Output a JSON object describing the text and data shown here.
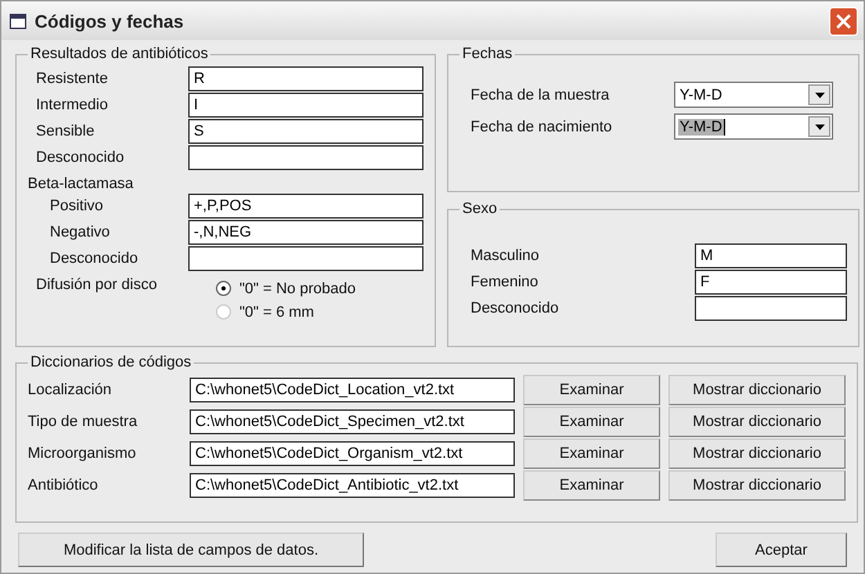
{
  "window": {
    "title": "Códigos y fechas"
  },
  "antibiotic_results": {
    "title": "Resultados de antibióticos",
    "fields": [
      {
        "label": "Resistente",
        "value": "R"
      },
      {
        "label": "Intermedio",
        "value": "I"
      },
      {
        "label": "Sensible",
        "value": "S"
      },
      {
        "label": "Desconocido"
      }
    ],
    "beta_lactamase": {
      "title": "Beta-lactamasa",
      "fields": [
        {
          "label": "Positivo",
          "value": "+,P,POS"
        },
        {
          "label": "Negativo",
          "value": "-,N,NEG"
        },
        {
          "label": "Desconocido"
        }
      ]
    },
    "disk_diffusion": {
      "label": "Difusión por disco",
      "options": [
        {
          "label": "\"0\" = No probado",
          "selected": true
        },
        {
          "label": "\"0\" = 6 mm",
          "selected": false
        }
      ]
    }
  },
  "dates": {
    "title": "Fechas",
    "fields": [
      {
        "label": "Fecha de la muestra",
        "value": "Y-M-D",
        "focused": false
      },
      {
        "label": "Fecha de nacimiento",
        "value": "Y-M-D",
        "focused": true
      }
    ]
  },
  "sex": {
    "title": "Sexo",
    "fields": [
      {
        "label": "Masculino",
        "value": "M"
      },
      {
        "label": "Femenino",
        "value": "F"
      },
      {
        "label": "Desconocido"
      }
    ]
  },
  "dictionaries": {
    "title": "Diccionarios de códigos",
    "rows": [
      {
        "label": "Localización",
        "path": "C:\\whonet5\\CodeDict_Location_vt2.txt",
        "browse": "Examinar",
        "show": "Mostrar diccionario"
      },
      {
        "label": "Tipo de muestra",
        "path": "C:\\whonet5\\CodeDict_Specimen_vt2.txt",
        "browse": "Examinar",
        "show": "Mostrar diccionario"
      },
      {
        "label": "Microorganismo",
        "path": "C:\\whonet5\\CodeDict_Organism_vt2.txt",
        "browse": "Examinar",
        "show": "Mostrar diccionario"
      },
      {
        "label": "Antibiótico",
        "path": "C:\\whonet5\\CodeDict_Antibiotic_vt2.txt",
        "browse": "Examinar",
        "show": "Mostrar diccionario"
      }
    ]
  },
  "buttons": [
    {
      "label": "Modificar la lista de campos de datos."
    },
    {
      "label": "Aceptar"
    }
  ]
}
